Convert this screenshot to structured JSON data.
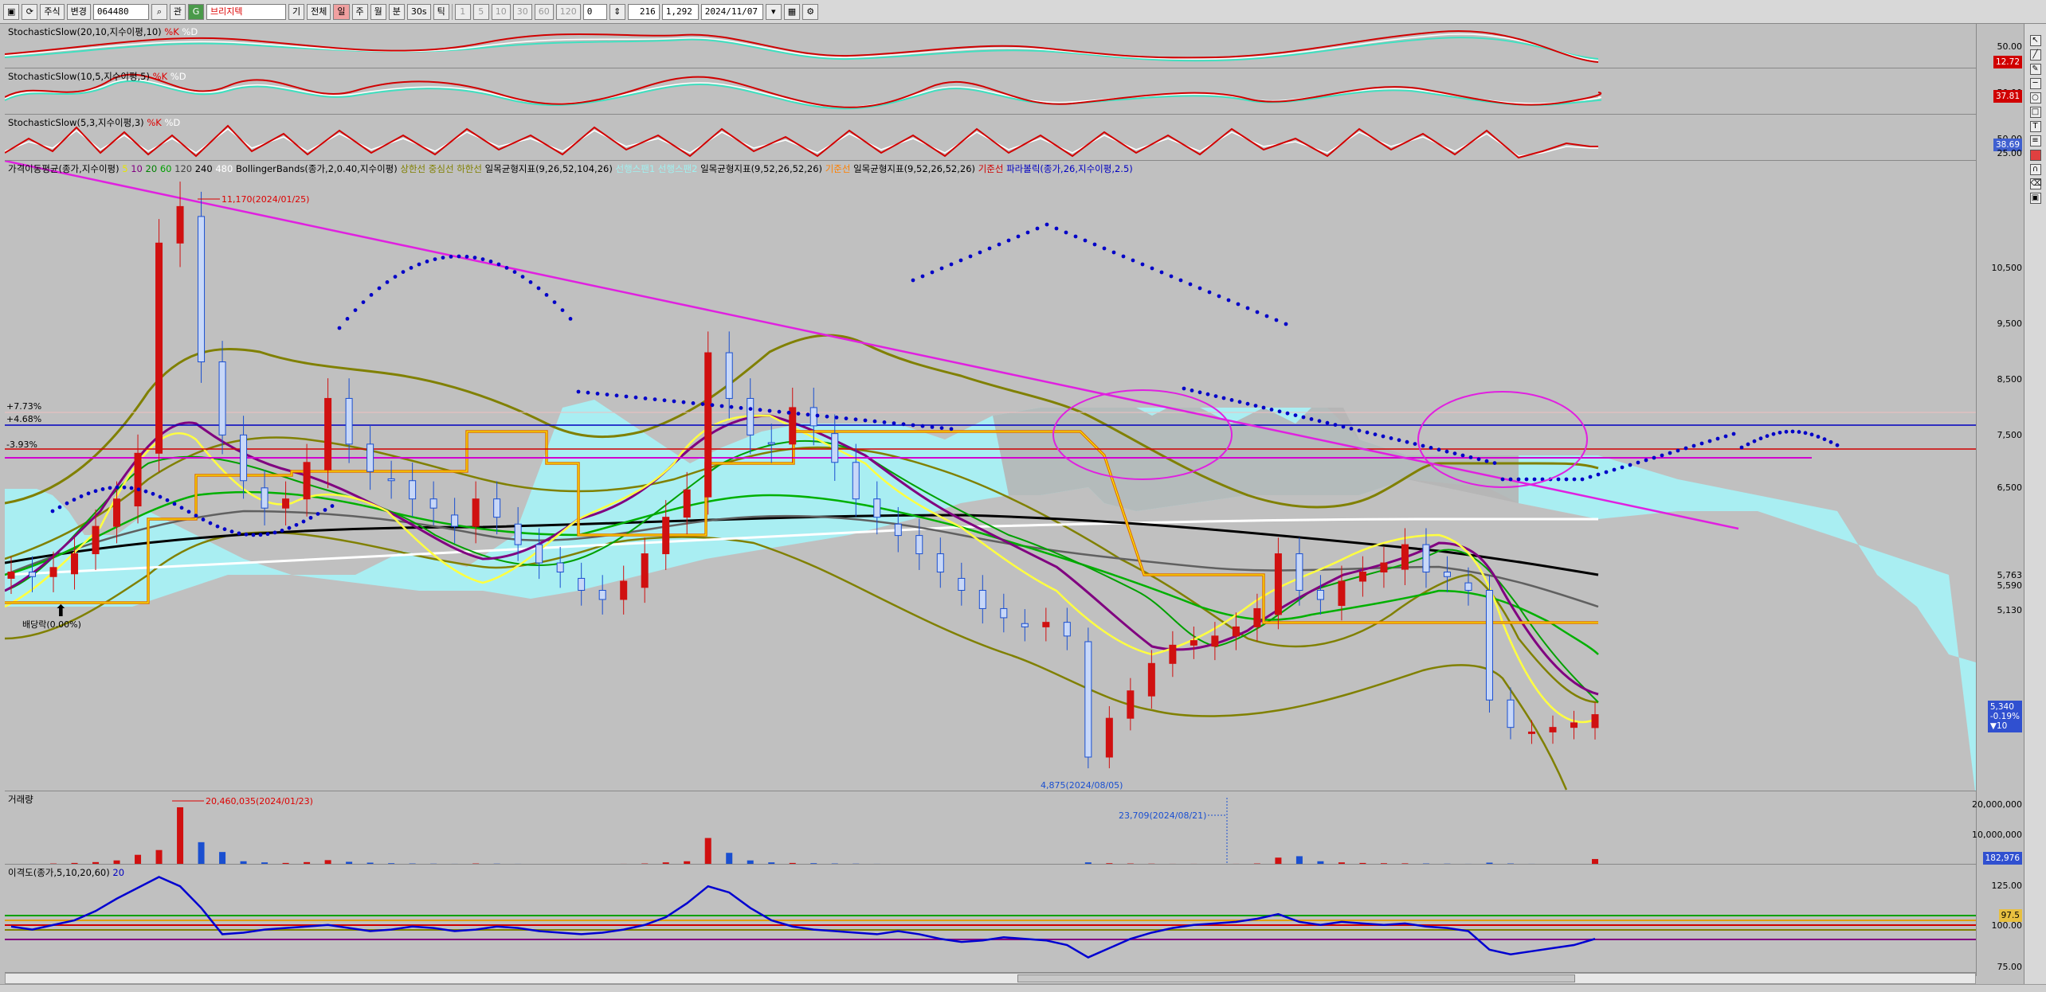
{
  "toolbar": {
    "market_select": "주식",
    "change_label": "변경",
    "code": "064480",
    "name": "브리지텍",
    "period_label": "기",
    "all_label": "전체",
    "day_label": "일",
    "week_label": "주",
    "month_label": "월",
    "minute_label": "분",
    "sec30_label": "30s",
    "tick_label": "틱",
    "n1": "1",
    "n5": "5",
    "n10": "10",
    "n30": "30",
    "n60": "60",
    "n120": "120",
    "zero": "0",
    "count": "216",
    "total": "1,292",
    "date": "2024/11/07"
  },
  "panels": {
    "stoch1": {
      "name": "StochasticSlow(20,10,지수이평,10)",
      "k": "%K",
      "d": "%D",
      "level_high": "50.00",
      "badge": "12.72"
    },
    "stoch2": {
      "name": "StochasticSlow(10,5,지수이평,5)",
      "k": "%K",
      "d": "%D",
      "level_high": "50.00",
      "badge": "37.81"
    },
    "stoch3": {
      "name": "StochasticSlow(5,3,지수이평,3)",
      "k": "%K",
      "d": "%D",
      "level_low": "25.00",
      "level_high": "50.00",
      "badge": "38.69"
    },
    "price": {
      "legend": [
        {
          "text": "가격이동평균(종가,지수이평)",
          "color": "#000000"
        },
        {
          "text": "5",
          "color": "#e6e600"
        },
        {
          "text": "10",
          "color": "#800080"
        },
        {
          "text": "20",
          "color": "#008000"
        },
        {
          "text": "60",
          "color": "#00a000"
        },
        {
          "text": "120",
          "color": "#404040"
        },
        {
          "text": "240",
          "color": "#000000"
        },
        {
          "text": "480",
          "color": "#ffffff"
        },
        {
          "text": "BollingerBands(종가,2,0.40,지수이평)",
          "color": "#000000"
        },
        {
          "text": "상한선",
          "color": "#808000"
        },
        {
          "text": "중심선",
          "color": "#808000"
        },
        {
          "text": "하한선",
          "color": "#808000"
        },
        {
          "text": "일목균형지표(9,26,52,104,26)",
          "color": "#000000"
        },
        {
          "text": "선행스팬1",
          "color": "#a0f0f0"
        },
        {
          "text": "선행스팬2",
          "color": "#a0f0f0"
        },
        {
          "text": "일목균형지표(9,52,26,52,26)",
          "color": "#000000"
        },
        {
          "text": "기준선",
          "color": "#ff8000"
        },
        {
          "text": "일목균형지표(9,52,26,52,26)",
          "color": "#000000"
        },
        {
          "text": "기준선",
          "color": "#d00000"
        },
        {
          "text": "파라볼릭(종가,26,지수이평,2.5)",
          "color": "#0000c0"
        }
      ],
      "ticks": [
        "10,500",
        "9,500",
        "8,500",
        "7,500",
        "6,500",
        "5,763",
        "5,590",
        "5,130"
      ],
      "high_annotation": "11,170(2024/01/25)",
      "low_annotation": "4,875(2024/08/05)",
      "dividend_label": "배당락(0.00%)",
      "pct_plus1": "+7.73%",
      "pct_plus2": "+4.68%",
      "pct_minus": "-3.93%",
      "badge_price": "5,340",
      "badge_change": "-0.19%",
      "badge_diff": "▼10"
    },
    "volume": {
      "name": "거래량",
      "high_annotation": "20,460,035(2024/01/23)",
      "mid_annotation": "23,709(2024/08/21)",
      "ticks": [
        "20,000,000",
        "10,000,000"
      ],
      "badge": "182,976"
    },
    "disparity": {
      "name": "이격도(종가,5,10,20,60)",
      "period_label": "20",
      "ticks": [
        "125.00",
        "100.00",
        "75.00"
      ],
      "badge": "97.5"
    }
  },
  "chart_data": [
    {
      "type": "candlestick",
      "title": "",
      "ylabel": "",
      "ylim": [
        4500,
        11400
      ],
      "series": [
        {
          "name": "Close",
          "values": [
            6900,
            6850,
            6950,
            7100,
            7400,
            7700,
            8200,
            10500,
            10900,
            9200,
            8400,
            7900,
            7600,
            7700,
            8100,
            8800,
            8300,
            8000,
            7900,
            7700,
            7600,
            7400,
            7700,
            7500,
            7200,
            7000,
            6900,
            6700,
            6600,
            6800,
            7100,
            7500,
            7800,
            9300,
            8800,
            8400,
            8300,
            8700,
            8500,
            8100,
            7700,
            7500,
            7300,
            7100,
            6900,
            6700,
            6500,
            6400,
            6300,
            6350,
            6200,
            4875,
            5300,
            5600,
            5900,
            6100,
            6150,
            6200,
            6300,
            6500,
            7100,
            6700,
            6600,
            6800,
            6900,
            7000,
            7200,
            6900,
            6850,
            6700,
            5500,
            5200,
            5150,
            5200,
            5250,
            5340
          ]
        }
      ],
      "annotations": [
        "11,170(2024/01/25)",
        "4,875(2024/08/05)"
      ]
    },
    {
      "type": "bar",
      "title": "거래량",
      "series": [
        {
          "name": "Volume",
          "values": [
            200000,
            300000,
            400000,
            600000,
            900000,
            1500000,
            3500000,
            5200000,
            20460035,
            8000000,
            4500000,
            1200000,
            800000,
            600000,
            900000,
            1600000,
            1000000,
            700000,
            500000,
            400000,
            350000,
            300000,
            400000,
            350000,
            300000,
            250000,
            250000,
            200000,
            200000,
            300000,
            400000,
            800000,
            1200000,
            9500000,
            4200000,
            1500000,
            800000,
            600000,
            500000,
            400000,
            350000,
            300000,
            280000,
            260000,
            250000,
            240000,
            230000,
            230000,
            220000,
            220000,
            220000,
            800000,
            500000,
            400000,
            350000,
            300000,
            300000,
            280000,
            300000,
            400000,
            2500000,
            3000000,
            1200000,
            800000,
            600000,
            500000,
            450000,
            400000,
            350000,
            300000,
            700000,
            400000,
            300000,
            250000,
            220000,
            2000000
          ]
        }
      ],
      "ylim": [
        0,
        25000000
      ]
    },
    {
      "type": "line",
      "title": "이격도(종가,5,10,20,60)",
      "ylim": [
        70,
        140
      ],
      "series": [
        {
          "name": "20",
          "values": [
            100,
            98,
            101,
            104,
            110,
            118,
            125,
            132,
            126,
            112,
            95,
            96,
            98,
            99,
            100,
            101,
            99,
            97,
            98,
            100,
            99,
            97,
            98,
            100,
            99,
            97,
            96,
            95,
            96,
            98,
            101,
            106,
            115,
            126,
            122,
            112,
            104,
            100,
            98,
            97,
            96,
            95,
            97,
            95,
            92,
            90,
            91,
            93,
            92,
            91,
            88,
            80,
            86,
            92,
            96,
            99,
            101,
            102,
            103,
            105,
            108,
            103,
            101,
            103,
            102,
            101,
            102,
            100,
            99,
            97,
            85,
            82,
            84,
            86,
            88,
            92
          ]
        }
      ],
      "reference_lines": [
        104,
        101,
        99,
        97,
        92
      ]
    }
  ],
  "colors": {
    "up": "#d01010",
    "down": "#1a4fd0",
    "cloud": "#a8f0f4",
    "trendline": "#e020e0",
    "parabolic": "#0000c8"
  }
}
